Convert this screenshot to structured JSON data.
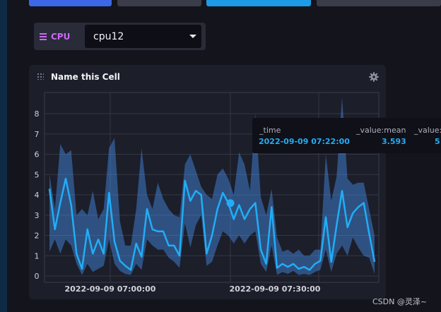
{
  "variables": {
    "tag_label": "CPU",
    "selected_value": "cpu12"
  },
  "cell": {
    "title": "Name this Cell"
  },
  "tooltip": {
    "columns": [
      {
        "header": "_time",
        "value": "2022-09-09 07:22:00"
      },
      {
        "header": "_value:mean",
        "value": "3.593"
      },
      {
        "header": "_value:",
        "value": "5"
      }
    ]
  },
  "watermark": "CSDN @灵泽~",
  "colors": {
    "line": "#22adf6",
    "band": "#4591ed",
    "accent": "#c969f2",
    "background": "#13141c"
  },
  "chart_data": {
    "type": "line",
    "x_tick_labels": [
      "2022-09-09 07:00:00",
      "2022-09-09 07:30:00"
    ],
    "ylim": [
      0,
      8.5
    ],
    "y_ticks": [
      0,
      1,
      2,
      3,
      4,
      5,
      6,
      7,
      8
    ],
    "grid": true,
    "hover_point": {
      "time": "2022-09-09 07:22:00",
      "value": 3.593
    },
    "series": [
      {
        "name": "_value:mean",
        "values": [
          4.3,
          2.3,
          3.6,
          4.8,
          3.5,
          1.1,
          0.35,
          2.3,
          1.1,
          1.8,
          1.1,
          4.1,
          1.7,
          0.75,
          0.5,
          0.3,
          1.6,
          0.95,
          3.3,
          2.3,
          2.2,
          2.2,
          1.5,
          1.5,
          1.0,
          4.7,
          3.7,
          4.2,
          4.0,
          1.1,
          2.0,
          3.3,
          4.1,
          3.6,
          2.8,
          3.5,
          2.8,
          3.3,
          3.6,
          1.3,
          0.6,
          3.4,
          0.4,
          0.6,
          0.45,
          0.6,
          0.35,
          0.45,
          0.3,
          0.6,
          0.75,
          2.9,
          0.7,
          2.5,
          4.2,
          2.4,
          3.1,
          3.4,
          3.6,
          2.1,
          0.7
        ],
        "upper": [
          5.0,
          3.3,
          6.5,
          6.0,
          6.2,
          3.0,
          3.3,
          3.0,
          4.2,
          2.8,
          3.3,
          6.3,
          6.8,
          2.7,
          1.5,
          1.5,
          3.3,
          6.3,
          4.0,
          3.3,
          4.6,
          3.8,
          3.3,
          3.0,
          2.9,
          5.5,
          6.0,
          5.2,
          4.4,
          4.0,
          3.8,
          5.0,
          5.3,
          4.8,
          4.0,
          6.1,
          5.5,
          4.2,
          8.0,
          3.9,
          3.0,
          4.3,
          1.9,
          1.2,
          1.3,
          1.1,
          1.3,
          1.0,
          1.0,
          1.3,
          1.3,
          6.0,
          3.7,
          4.9,
          8.8,
          4.8,
          4.5,
          4.6,
          4.6,
          3.3,
          2.0
        ],
        "lower": [
          1.2,
          1.8,
          1.1,
          1.8,
          1.5,
          0.6,
          0.05,
          0.6,
          0.2,
          0.35,
          0.5,
          1.8,
          0.6,
          0.25,
          0.1,
          0.05,
          0.6,
          0.3,
          1.8,
          1.5,
          1.3,
          1.3,
          0.9,
          0.7,
          0.4,
          2.6,
          1.4,
          2.5,
          3.0,
          0.5,
          0.7,
          1.5,
          2.2,
          2.0,
          1.6,
          2.0,
          1.6,
          2.0,
          2.2,
          0.6,
          0.2,
          1.5,
          0.05,
          0.2,
          0.1,
          0.25,
          0.05,
          0.1,
          0.05,
          0.2,
          0.3,
          1.3,
          0.2,
          1.1,
          1.5,
          1.0,
          1.9,
          1.4,
          1.0,
          0.9,
          0.1
        ]
      }
    ]
  }
}
